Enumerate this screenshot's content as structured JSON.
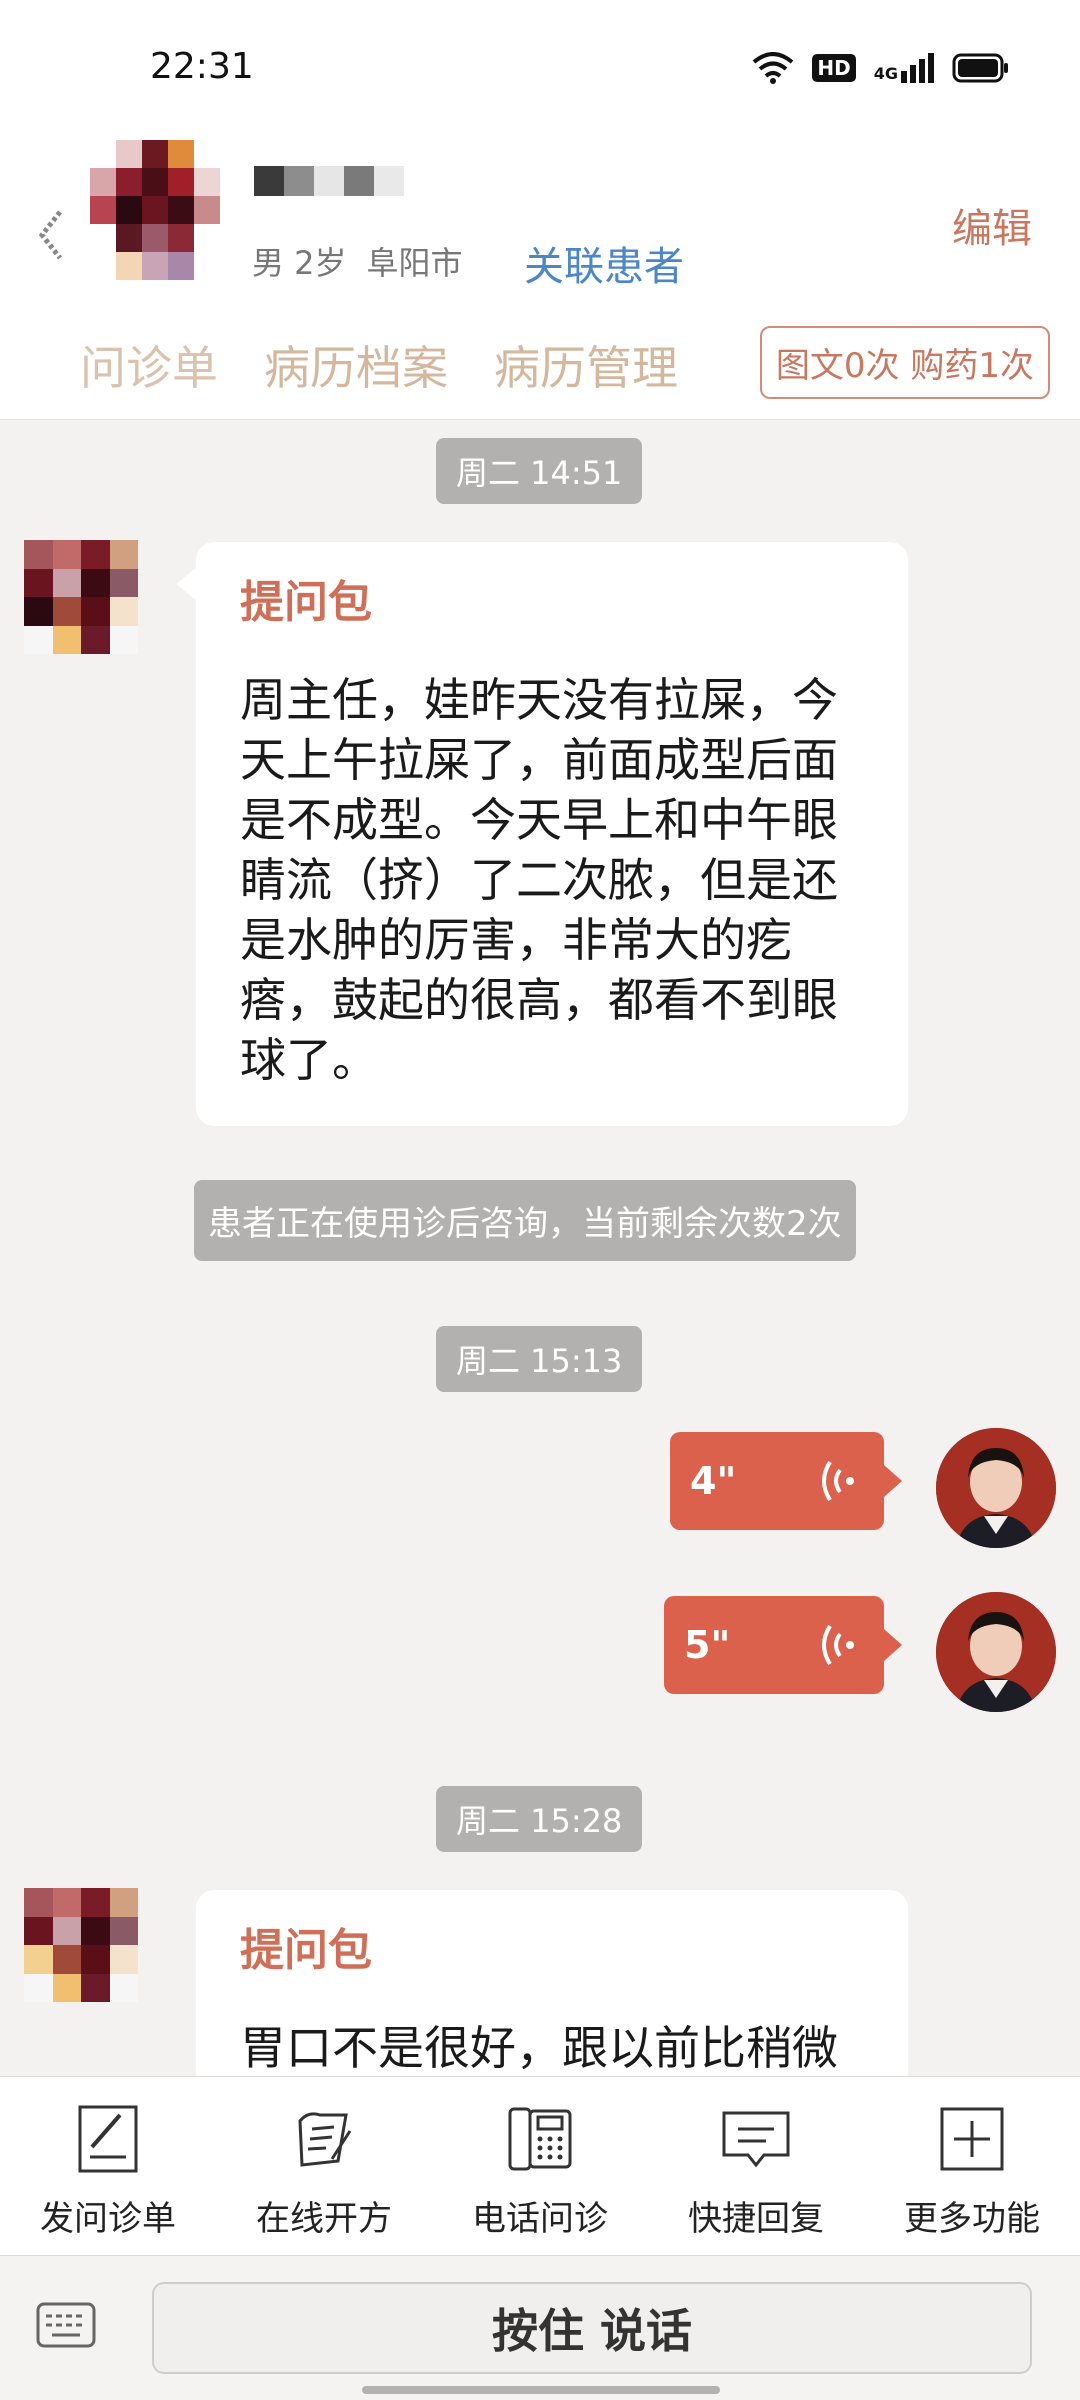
{
  "status_bar": {
    "time": "22:31",
    "hd_label": "HD",
    "network_label": "4G"
  },
  "header": {
    "patient_meta": [
      "男 2岁",
      "阜阳市"
    ],
    "link_patient_label": "关联患者",
    "edit_label": "编辑",
    "tabs": [
      "问诊单",
      "病历档案",
      "病历管理"
    ],
    "quota_label": "图文0次 购药1次"
  },
  "chat": {
    "time_1": "周二 14:51",
    "msg_1_title": "提问包",
    "msg_1_text": "周主任，娃昨天没有拉屎，今天上午拉屎了，前面成型后面是不成型。今天早上和中午眼睛流（挤）了二次脓，但是还是水肿的厉害，非常大的疙瘩，鼓起的很高，都看不到眼球了。",
    "system_notice": "患者正在使用诊后咨询，当前剩余次数2次",
    "time_2": "周二 15:13",
    "voice_1_duration": "4\"",
    "voice_2_duration": "5\"",
    "time_3": "周二 15:28",
    "msg_2_title": "提问包",
    "msg_2_text": "胃口不是很好，跟以前比稍微"
  },
  "toolbar": {
    "items": [
      {
        "label": "发问诊单",
        "icon": "form-pen-icon"
      },
      {
        "label": "在线开方",
        "icon": "prescription-icon"
      },
      {
        "label": "电话问诊",
        "icon": "phone-icon"
      },
      {
        "label": "快捷回复",
        "icon": "chat-bubble-icon"
      },
      {
        "label": "更多功能",
        "icon": "plus-icon"
      }
    ]
  },
  "input_bar": {
    "talk_label": "按住 说话"
  },
  "colors": {
    "accent_red": "#dc614c",
    "title_red": "#cf6f58",
    "link_blue": "#4a86c8",
    "tab_tan": "#d4b89e"
  }
}
